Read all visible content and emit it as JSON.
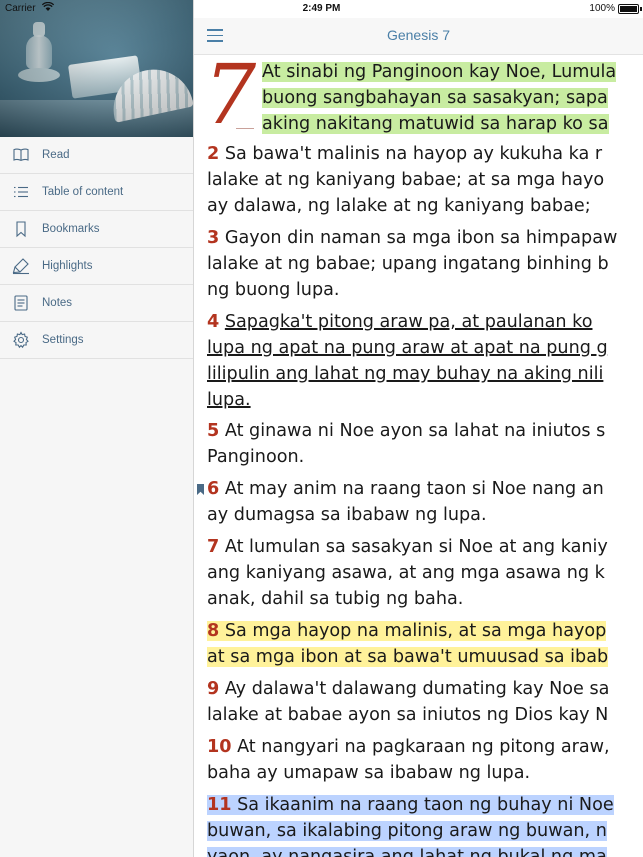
{
  "status_bar": {
    "carrier": "Carrier",
    "time": "2:49 PM",
    "battery": "100%"
  },
  "sidebar": {
    "items": [
      {
        "label": "Read",
        "icon": "book-icon"
      },
      {
        "label": "Table of content",
        "icon": "list-icon"
      },
      {
        "label": "Bookmarks",
        "icon": "bookmark-icon"
      },
      {
        "label": "Highlights",
        "icon": "highlighter-icon"
      },
      {
        "label": "Notes",
        "icon": "note-icon"
      },
      {
        "label": "Settings",
        "icon": "gear-icon"
      }
    ],
    "accent_color": "#4a6a86"
  },
  "navbar": {
    "title": "Genesis 7",
    "accent_color": "#4a7fa7"
  },
  "reader": {
    "chapter_number": "7",
    "verse_number_color": "#b3341f",
    "highlight_colors": {
      "green": "#c8eca1",
      "yellow": "#fff29a",
      "blue": "#bcd3ff"
    },
    "verse1_lines": [
      "At sinabi ng Panginoon kay Noe, Lumula",
      "buong sangbahayan sa sasakyan; sapa",
      "aking nakitang matuwid sa harap ko sa"
    ],
    "verses": [
      {
        "num": "2",
        "lines": [
          "Sa bawa't malinis na hayop ay kukuha ka r",
          "lalake at ng kaniyang babae; at sa mga hayo",
          "ay dalawa, ng lalake at ng kaniyang babae;"
        ]
      },
      {
        "num": "3",
        "lines": [
          "Gayon din naman sa mga ibon sa himpapaw",
          "lalake at ng babae; upang ingatang binhing b",
          "ng buong lupa."
        ]
      },
      {
        "num": "4",
        "lines": [
          "Sapagka't pitong araw pa, at paulanan ko",
          "lupa ng apat na pung araw at apat na pung g",
          "lilipulin ang lahat ng may buhay na aking nili",
          "lupa."
        ]
      },
      {
        "num": "5",
        "lines": [
          "At ginawa ni Noe ayon sa lahat na iniutos s",
          "Panginoon."
        ]
      },
      {
        "num": "6",
        "lines": [
          "At may anim na raang taon si Noe nang an",
          "ay dumagsa sa ibabaw ng lupa."
        ]
      },
      {
        "num": "7",
        "lines": [
          "At lumulan sa sasakyan si Noe at ang kaniy",
          "ang kaniyang asawa, at ang mga asawa ng k",
          "anak, dahil sa tubig ng baha."
        ]
      },
      {
        "num": "8",
        "lines": [
          "Sa mga hayop na malinis, at sa mga hayop",
          "at sa mga ibon at sa bawa't umuusad sa ibab"
        ]
      },
      {
        "num": "9",
        "lines": [
          "Ay dalawa't dalawang dumating kay Noe sa",
          "lalake at babae ayon sa iniutos ng Dios kay N"
        ]
      },
      {
        "num": "10",
        "lines": [
          "At nangyari na pagkaraan ng pitong araw,",
          "baha ay umapaw sa ibabaw ng lupa."
        ]
      },
      {
        "num": "11",
        "lines": [
          "Sa ikaanim na raang taon ng buhay ni Noe",
          "buwan, sa ikalabing pitong araw ng buwan, n",
          "yaon, ay nangasira ang lahat ng bukal ng ma"
        ]
      }
    ]
  }
}
